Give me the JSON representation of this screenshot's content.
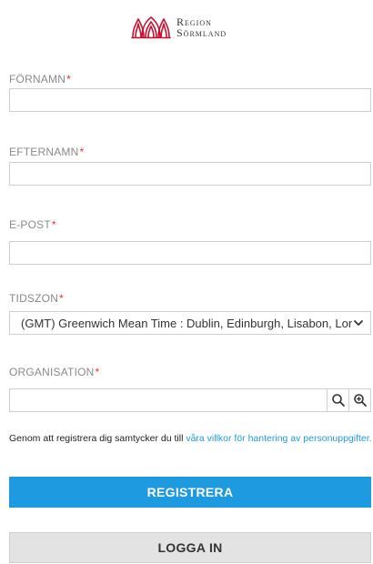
{
  "logo": {
    "line1": "Region",
    "line2": "Sörmland",
    "color": "#c8102e"
  },
  "form": {
    "firstname": {
      "label": "FÖRNAMN",
      "required": "*",
      "value": ""
    },
    "lastname": {
      "label": "EFTERNAMN",
      "required": "*",
      "value": ""
    },
    "email": {
      "label": "E-POST",
      "required": "*",
      "value": ""
    },
    "timezone": {
      "label": "TIDSZON",
      "required": "*",
      "selected": "(GMT) Greenwich Mean Time : Dublin, Edinburgh, Lisabon, London"
    },
    "organisation": {
      "label": "ORGANISATION",
      "required": "*",
      "value": ""
    }
  },
  "consent": {
    "text": "Genom att registrera dig samtycker du till ",
    "link": "våra villkor för hantering av personuppgifter."
  },
  "buttons": {
    "register": "REGISTRERA",
    "login": "LOGGA IN"
  },
  "colors": {
    "primary": "#1e9be0",
    "required": "#e0362c",
    "label": "#8a8a8a",
    "secondary_bg": "#e3e3e3"
  },
  "icons": {
    "search": "search-icon",
    "zoom": "zoom-in-icon",
    "chevron": "chevron-down-icon"
  }
}
